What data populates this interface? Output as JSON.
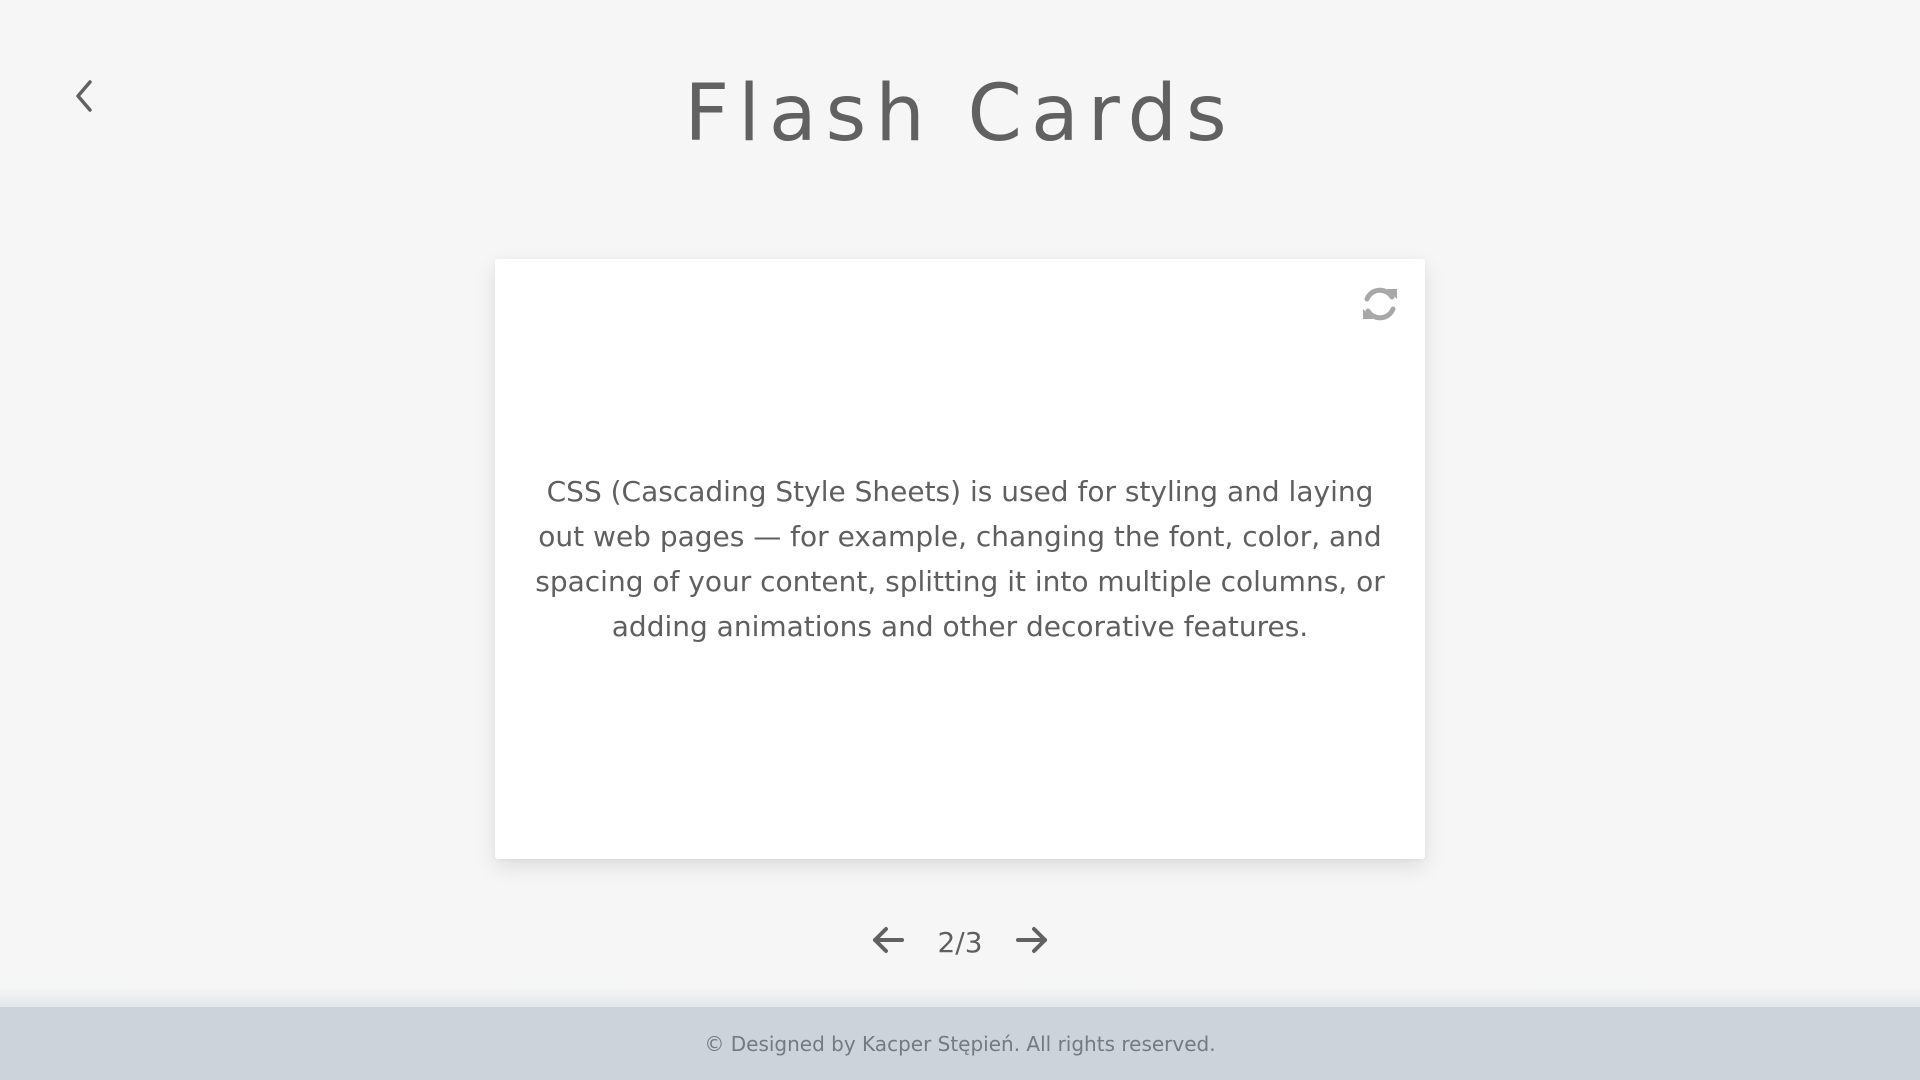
{
  "header": {
    "title": "Flash Cards",
    "back_icon": "chevron-left-icon"
  },
  "card": {
    "text": "CSS (Cascading Style Sheets) is used for styling and laying out web pages — for example, changing the font, color, and spacing of your content, splitting it into multiple columns, or adding animations and other decorative features.",
    "flip_icon": "refresh-icon"
  },
  "pager": {
    "current": 2,
    "total": 3,
    "label": "2/3",
    "prev_icon": "arrow-left-icon",
    "next_icon": "arrow-right-icon"
  },
  "footer": {
    "text": "© Designed by Kacper Stępień. All rights reserved."
  },
  "colors": {
    "background": "#f6f6f6",
    "card": "#ffffff",
    "text": "#616161",
    "footer": "#cdd3db",
    "icon_muted": "#a8a8a8"
  }
}
